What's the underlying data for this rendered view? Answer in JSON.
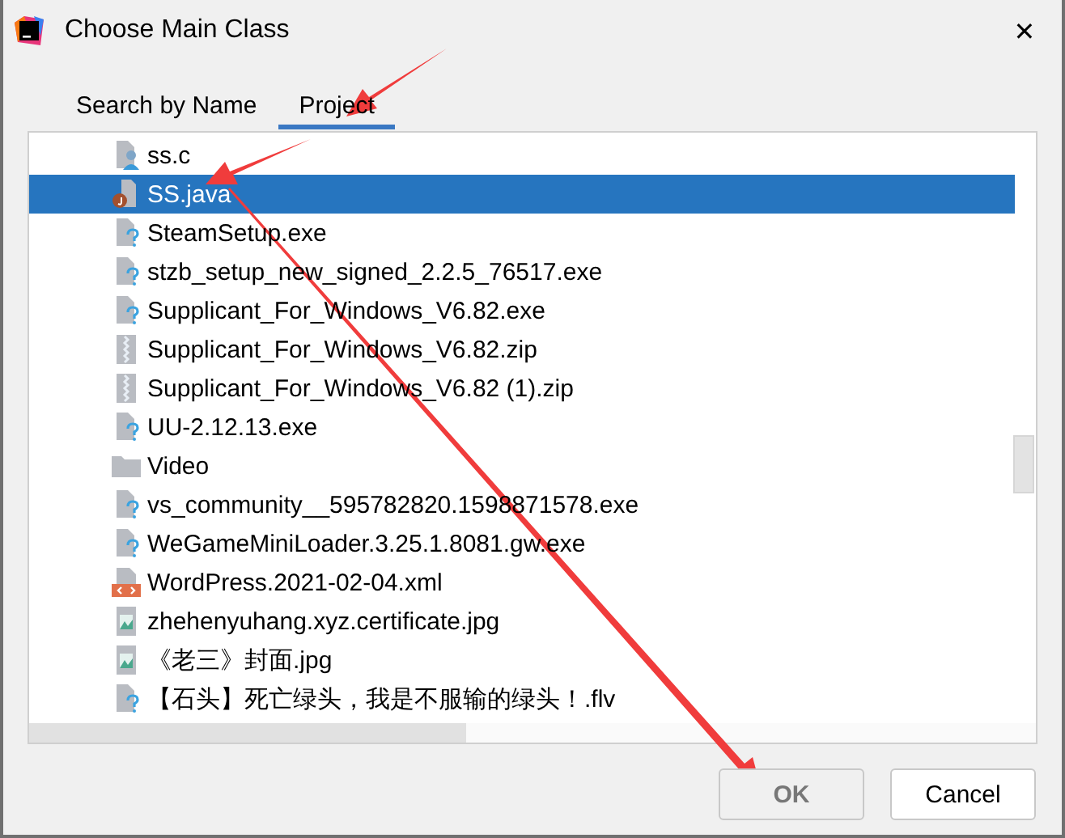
{
  "window": {
    "title": "Choose Main Class",
    "close": "✕"
  },
  "tabs": [
    {
      "label": "Search by Name",
      "selected": false
    },
    {
      "label": "Project",
      "selected": true
    }
  ],
  "files": [
    {
      "name": "ss.c",
      "kind": "c",
      "selected": false
    },
    {
      "name": "SS.java",
      "kind": "java",
      "selected": true
    },
    {
      "name": "SteamSetup.exe",
      "kind": "unknown",
      "selected": false
    },
    {
      "name": "stzb_setup_new_signed_2.2.5_76517.exe",
      "kind": "unknown",
      "selected": false
    },
    {
      "name": "Supplicant_For_Windows_V6.82.exe",
      "kind": "unknown",
      "selected": false
    },
    {
      "name": "Supplicant_For_Windows_V6.82.zip",
      "kind": "zip",
      "selected": false
    },
    {
      "name": "Supplicant_For_Windows_V6.82 (1).zip",
      "kind": "zip",
      "selected": false
    },
    {
      "name": "UU-2.12.13.exe",
      "kind": "unknown",
      "selected": false
    },
    {
      "name": "Video",
      "kind": "folder",
      "selected": false
    },
    {
      "name": "vs_community__595782820.1598871578.exe",
      "kind": "unknown",
      "selected": false
    },
    {
      "name": "WeGameMiniLoader.3.25.1.8081.gw.exe",
      "kind": "unknown",
      "selected": false
    },
    {
      "name": "WordPress.2021-02-04.xml",
      "kind": "xml",
      "selected": false
    },
    {
      "name": "zhehenyuhang.xyz.certificate.jpg",
      "kind": "image",
      "selected": false
    },
    {
      "name": "《老三》封面.jpg",
      "kind": "image",
      "selected": false
    },
    {
      "name": "【石头】死亡绿头，我是不服输的绿头！.flv",
      "kind": "unknown",
      "selected": false
    }
  ],
  "buttons": [
    {
      "label": "OK",
      "disabled": true
    },
    {
      "label": "Cancel",
      "disabled": false
    }
  ]
}
